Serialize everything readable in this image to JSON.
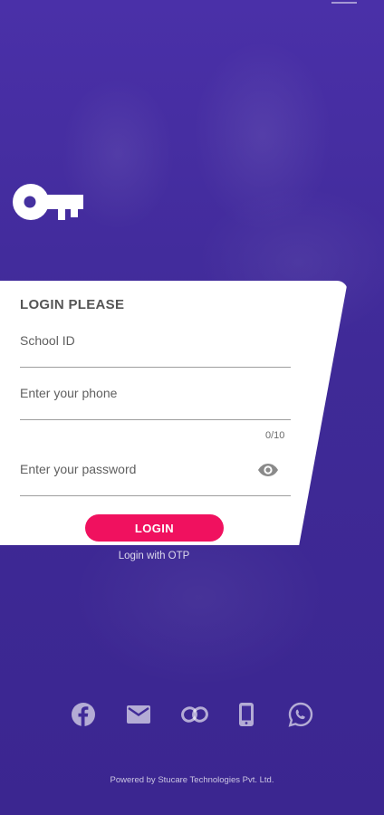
{
  "login": {
    "title": "LOGIN PLEASE",
    "school_id_placeholder": "School ID",
    "phone_placeholder": "Enter your phone",
    "phone_counter": "0/10",
    "password_placeholder": "Enter your password",
    "login_button": "LOGIN",
    "otp_link": "Login with OTP"
  },
  "social_icons": [
    "facebook-icon",
    "mail-icon",
    "link-icon",
    "mobile-icon",
    "whatsapp-icon"
  ],
  "footer": "Powered by Stucare Technologies Pvt. Ltd.",
  "colors": {
    "background": "#3f2a94",
    "accent": "#f0115f",
    "card": "#ffffff"
  }
}
